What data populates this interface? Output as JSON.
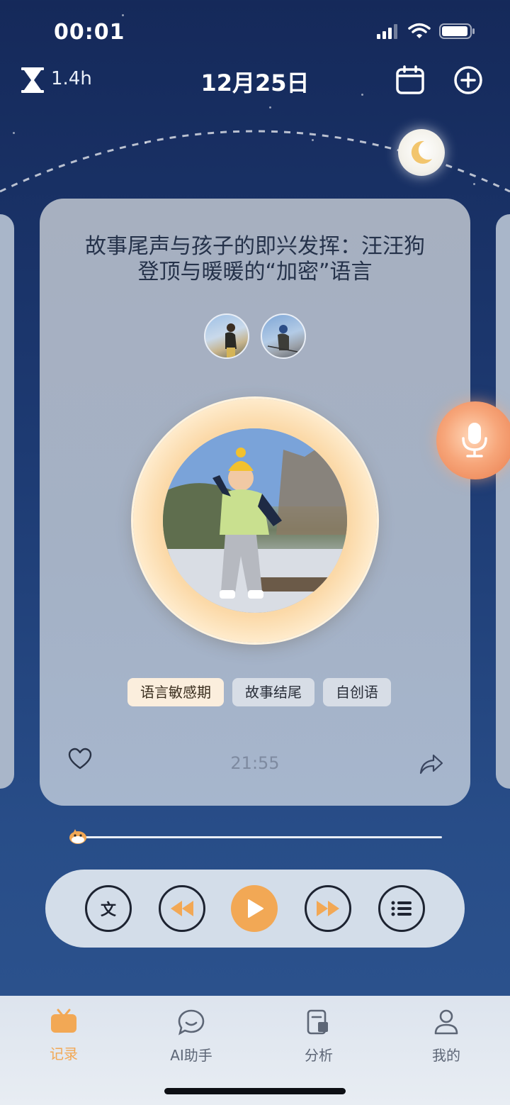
{
  "status_bar": {
    "time": "00:01",
    "icons": [
      "signal-icon",
      "wifi-icon",
      "battery-icon"
    ]
  },
  "header": {
    "sleep_hours": "1.4h",
    "date": "12月25日",
    "icons": [
      "hourglass-icon",
      "calendar-icon",
      "add-icon",
      "moon-icon"
    ]
  },
  "card": {
    "title": "故事尾声与孩子的即兴发挥：汪汪狗登顶与暖暖的“加密”语言",
    "tags": [
      "语言敏感期",
      "故事结尾",
      "自创语"
    ],
    "duration": "21:55"
  },
  "player": {
    "progress": 0.01,
    "text_button": "文"
  },
  "tabbar": {
    "items": [
      {
        "label": "记录",
        "icon": "tv-icon",
        "active": true
      },
      {
        "label": "AI助手",
        "icon": "chat-smile-icon",
        "active": false
      },
      {
        "label": "分析",
        "icon": "report-icon",
        "active": false
      },
      {
        "label": "我的",
        "icon": "user-icon",
        "active": false
      }
    ]
  },
  "colors": {
    "accent": "#f2a855",
    "background": "#1d3a72",
    "card": "#a7b2c4",
    "mic": "#f39a6c"
  }
}
